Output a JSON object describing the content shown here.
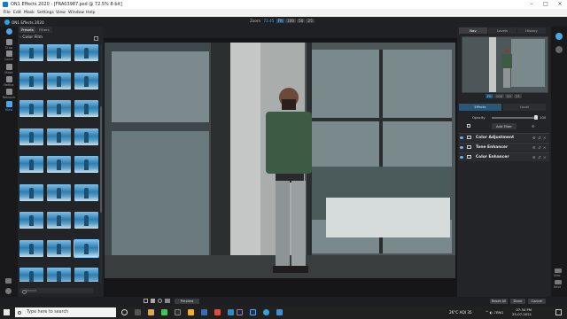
{
  "window": {
    "title": "ON1 Effects 2020 - [FRA03987.psd @ 72.5% 8-bit]"
  },
  "menu": {
    "items": [
      "File",
      "Edit",
      "Mask",
      "Settings",
      "View",
      "Window",
      "Help"
    ]
  },
  "app": {
    "name": "ON1 Effects 2020"
  },
  "zoom": {
    "label": "Zoom",
    "value": "72.45",
    "buttons": [
      "FIt",
      "100",
      "50",
      "25"
    ],
    "active": "FIt"
  },
  "tools": [
    {
      "label": "Crop",
      "icon": "crop-icon"
    },
    {
      "label": "Local",
      "icon": "brush-icon"
    },
    {
      "label": "Mask",
      "icon": "mask-icon"
    },
    {
      "label": "Refine",
      "icon": "refine-brush-icon"
    },
    {
      "label": "Retouch",
      "icon": "retouch-icon"
    },
    {
      "label": "View",
      "icon": "hand-icon"
    }
  ],
  "browser": {
    "tabs": [
      "Presets",
      "Filters"
    ],
    "active_tab": "Presets",
    "category": "Color Film",
    "search_placeholder": "Search",
    "thumb_count": 27
  },
  "right_tabs": {
    "tabs": [
      "Nav",
      "Levels",
      "History"
    ],
    "active": "Nav"
  },
  "nav_zoom": {
    "buttons": [
      "FIt",
      "100",
      "50",
      "25"
    ],
    "active": "FIt"
  },
  "effects": {
    "tabs": [
      "Effects",
      "Local"
    ],
    "active": "Effects",
    "opacity_label": "Opacity",
    "opacity": "100",
    "add_filter": "Add Filter",
    "filters": [
      "Color Adjustment",
      "Tone Enhancer",
      "Color Enhancer"
    ]
  },
  "right_tools": [
    "Side",
    "Next"
  ],
  "bottom": {
    "preview": "Preview",
    "reset": "Reset All",
    "done": "Done",
    "cancel": "Cancel"
  },
  "taskbar": {
    "search_placeholder": "Type here to search",
    "weather": "26°C  AQI 35",
    "time": "07:34 PM",
    "date": "25-07-2021",
    "lang": "ENG"
  },
  "colors": {
    "accent": "#49a9e6",
    "panel": "#232427",
    "background": "#1b1c1e"
  }
}
